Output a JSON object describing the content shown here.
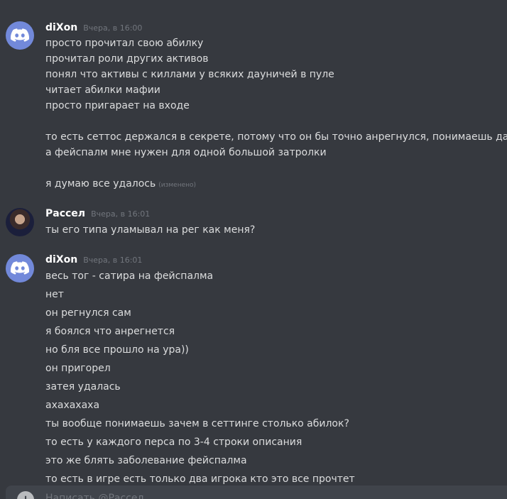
{
  "top_clip_text": "…",
  "groups": [
    {
      "username": "diXon",
      "timestamp": "Вчера, в 16:00",
      "avatar": "discord-logo-avatar",
      "lines": [
        "просто прочитал свою абилку",
        "прочитал роли других активов",
        "понял что активы с киллами у всяких дауничей в пуле",
        "читает абилки мафии",
        "просто пригарает на входе",
        "",
        "то есть сеттос держался в секрете, потому что он бы точно анрегнулся, понимаешь да?",
        "а фейспалм мне нужен для одной большой затролки",
        "",
        "я думаю все удалось"
      ],
      "edited_label": "(изменено)"
    },
    {
      "username": "Рассел",
      "timestamp": "Вчера, в 16:01",
      "avatar": "photo-avatar",
      "lines": [
        "ты его типа уламывал на рег как меня?"
      ]
    },
    {
      "username": "diXon",
      "timestamp": "Вчера, в 16:01",
      "avatar": "discord-logo-avatar",
      "lines": [
        "весь тог - сатира на фейспалма",
        "нет",
        "он регнулся сам",
        "я боялся что анрегнется",
        "но бля все прошло на ура))",
        "он пригорел",
        "затея удалась",
        "ахахахаха",
        "ты вообще понимаешь зачем в сеттинге столько абилок?",
        "то есть  у каждого перса по 3-4 строки описания",
        "это же блять заболевание фейспалма",
        "то есть в игре есть только два игрока кто это все прочтет"
      ]
    }
  ],
  "composer": {
    "plus_label": "+",
    "placeholder": "Написать @Рассел"
  },
  "colors": {
    "background": "#36393f",
    "text": "#dcddde",
    "muted": "#72767d",
    "discord_blurple": "#7289da"
  }
}
